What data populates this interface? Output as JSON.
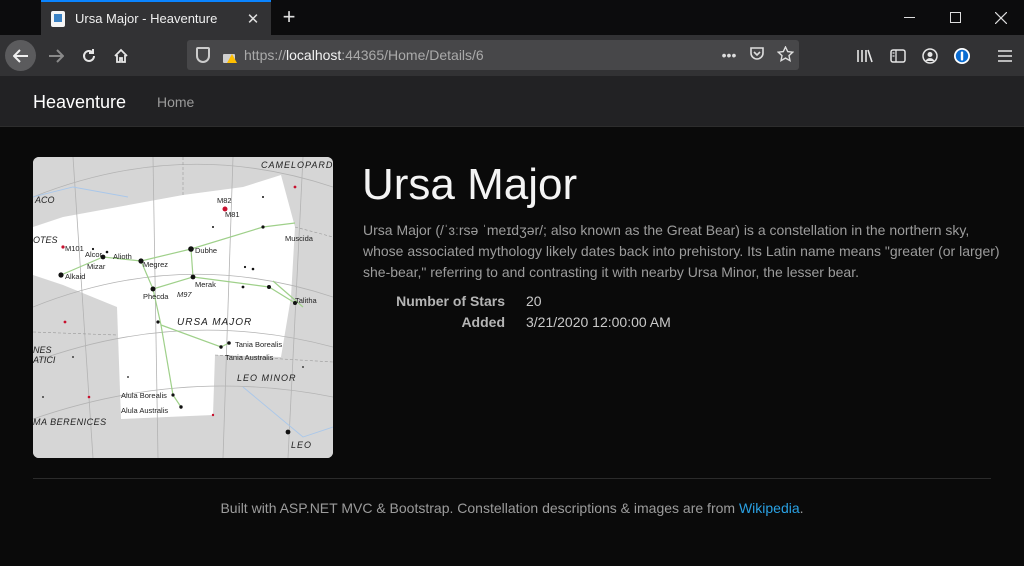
{
  "browser": {
    "tab_title": "Ursa Major - Heaventure",
    "url_scheme": "https://",
    "url_host": "localhost",
    "url_rest": ":44365/Home/Details/6"
  },
  "site": {
    "brand": "Heaventure",
    "nav_home": "Home"
  },
  "constellation": {
    "name": "Ursa Major",
    "description": "Ursa Major (/ˈɜːrsə ˈmeɪdʒər/; also known as the Great Bear) is a constellation in the northern sky, whose associated mythology likely dates back into prehistory. Its Latin name means \"greater (or larger) she-bear,\" referring to and contrasting it with nearby Ursa Minor, the lesser bear.",
    "details": [
      {
        "label": "Number of Stars",
        "value": "20"
      },
      {
        "label": "Added",
        "value": "3/21/2020 12:00:00 AM"
      }
    ]
  },
  "chart_labels": {
    "camelopardalis": "CAMELOPARD",
    "ursa_major": "URSA MAJOR",
    "leo_minor": "LEO MINOR",
    "leo": "LEO",
    "berenices": "MA BERENICES",
    "canes": "NES",
    "canes2": "ATICI",
    "bootes": "OTES",
    "draco": "ACO",
    "stars": [
      "M82",
      "M81",
      "Dubhe",
      "Muscida",
      "M101",
      "Alcor",
      "Alioth",
      "Megrez",
      "Mizar",
      "Alkaid",
      "Phecda",
      "Merak",
      "M97",
      "Talitha",
      "Tania Borealis",
      "Tania Australis",
      "Alula Borealis",
      "Alula Australis"
    ]
  },
  "footer": {
    "text": "Built with ASP.NET MVC & Bootstrap. Constellation descriptions & images are from ",
    "link": "Wikipedia",
    "tail": "."
  },
  "icons": {
    "back": "arrow-left-icon",
    "forward": "arrow-right-icon",
    "reload": "reload-icon",
    "home": "home-icon",
    "library": "library-icon",
    "sidebar": "sidebar-icon",
    "account": "account-icon",
    "extension": "password-manager-icon",
    "menu": "hamburger-menu-icon"
  },
  "colors": {
    "accent": "#0a84ff",
    "link": "#2aa1e3",
    "background": "#0a0a0a",
    "navbar": "#222224"
  }
}
